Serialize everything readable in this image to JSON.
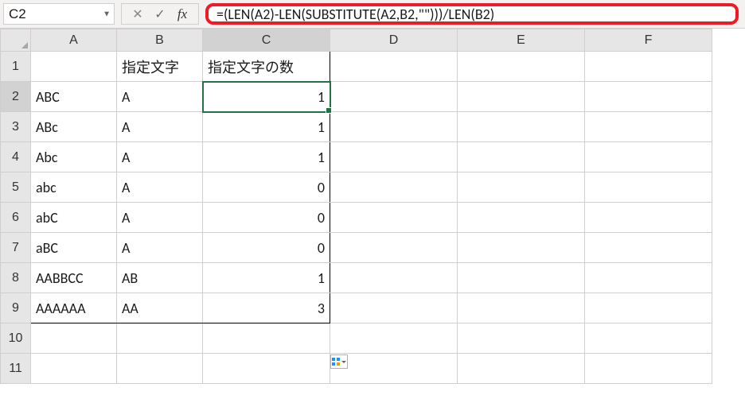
{
  "formula_bar": {
    "name_box_value": "C2",
    "formula_text": "=(LEN(A2)-LEN(SUBSTITUTE(A2,B2,\"\")))/LEN(B2)"
  },
  "columns": [
    "A",
    "B",
    "C",
    "D",
    "E",
    "F"
  ],
  "row_numbers": [
    "1",
    "2",
    "3",
    "4",
    "5",
    "6",
    "7",
    "8",
    "9",
    "10",
    "11"
  ],
  "headers": {
    "B": "指定文字",
    "C": "指定文字の数"
  },
  "rows": [
    {
      "A": "ABC",
      "B": "A",
      "C": "1"
    },
    {
      "A": "ABc",
      "B": "A",
      "C": "1"
    },
    {
      "A": "Abc",
      "B": "A",
      "C": "1"
    },
    {
      "A": "abc",
      "B": "A",
      "C": "0"
    },
    {
      "A": "abC",
      "B": "A",
      "C": "0"
    },
    {
      "A": "aBC",
      "B": "A",
      "C": "0"
    },
    {
      "A": "AABBCC",
      "B": "AB",
      "C": "1"
    },
    {
      "A": "AAAAAA",
      "B": "AA",
      "C": "3"
    }
  ],
  "selected_cell": "C2",
  "selected_col": "C",
  "selected_row": "2"
}
